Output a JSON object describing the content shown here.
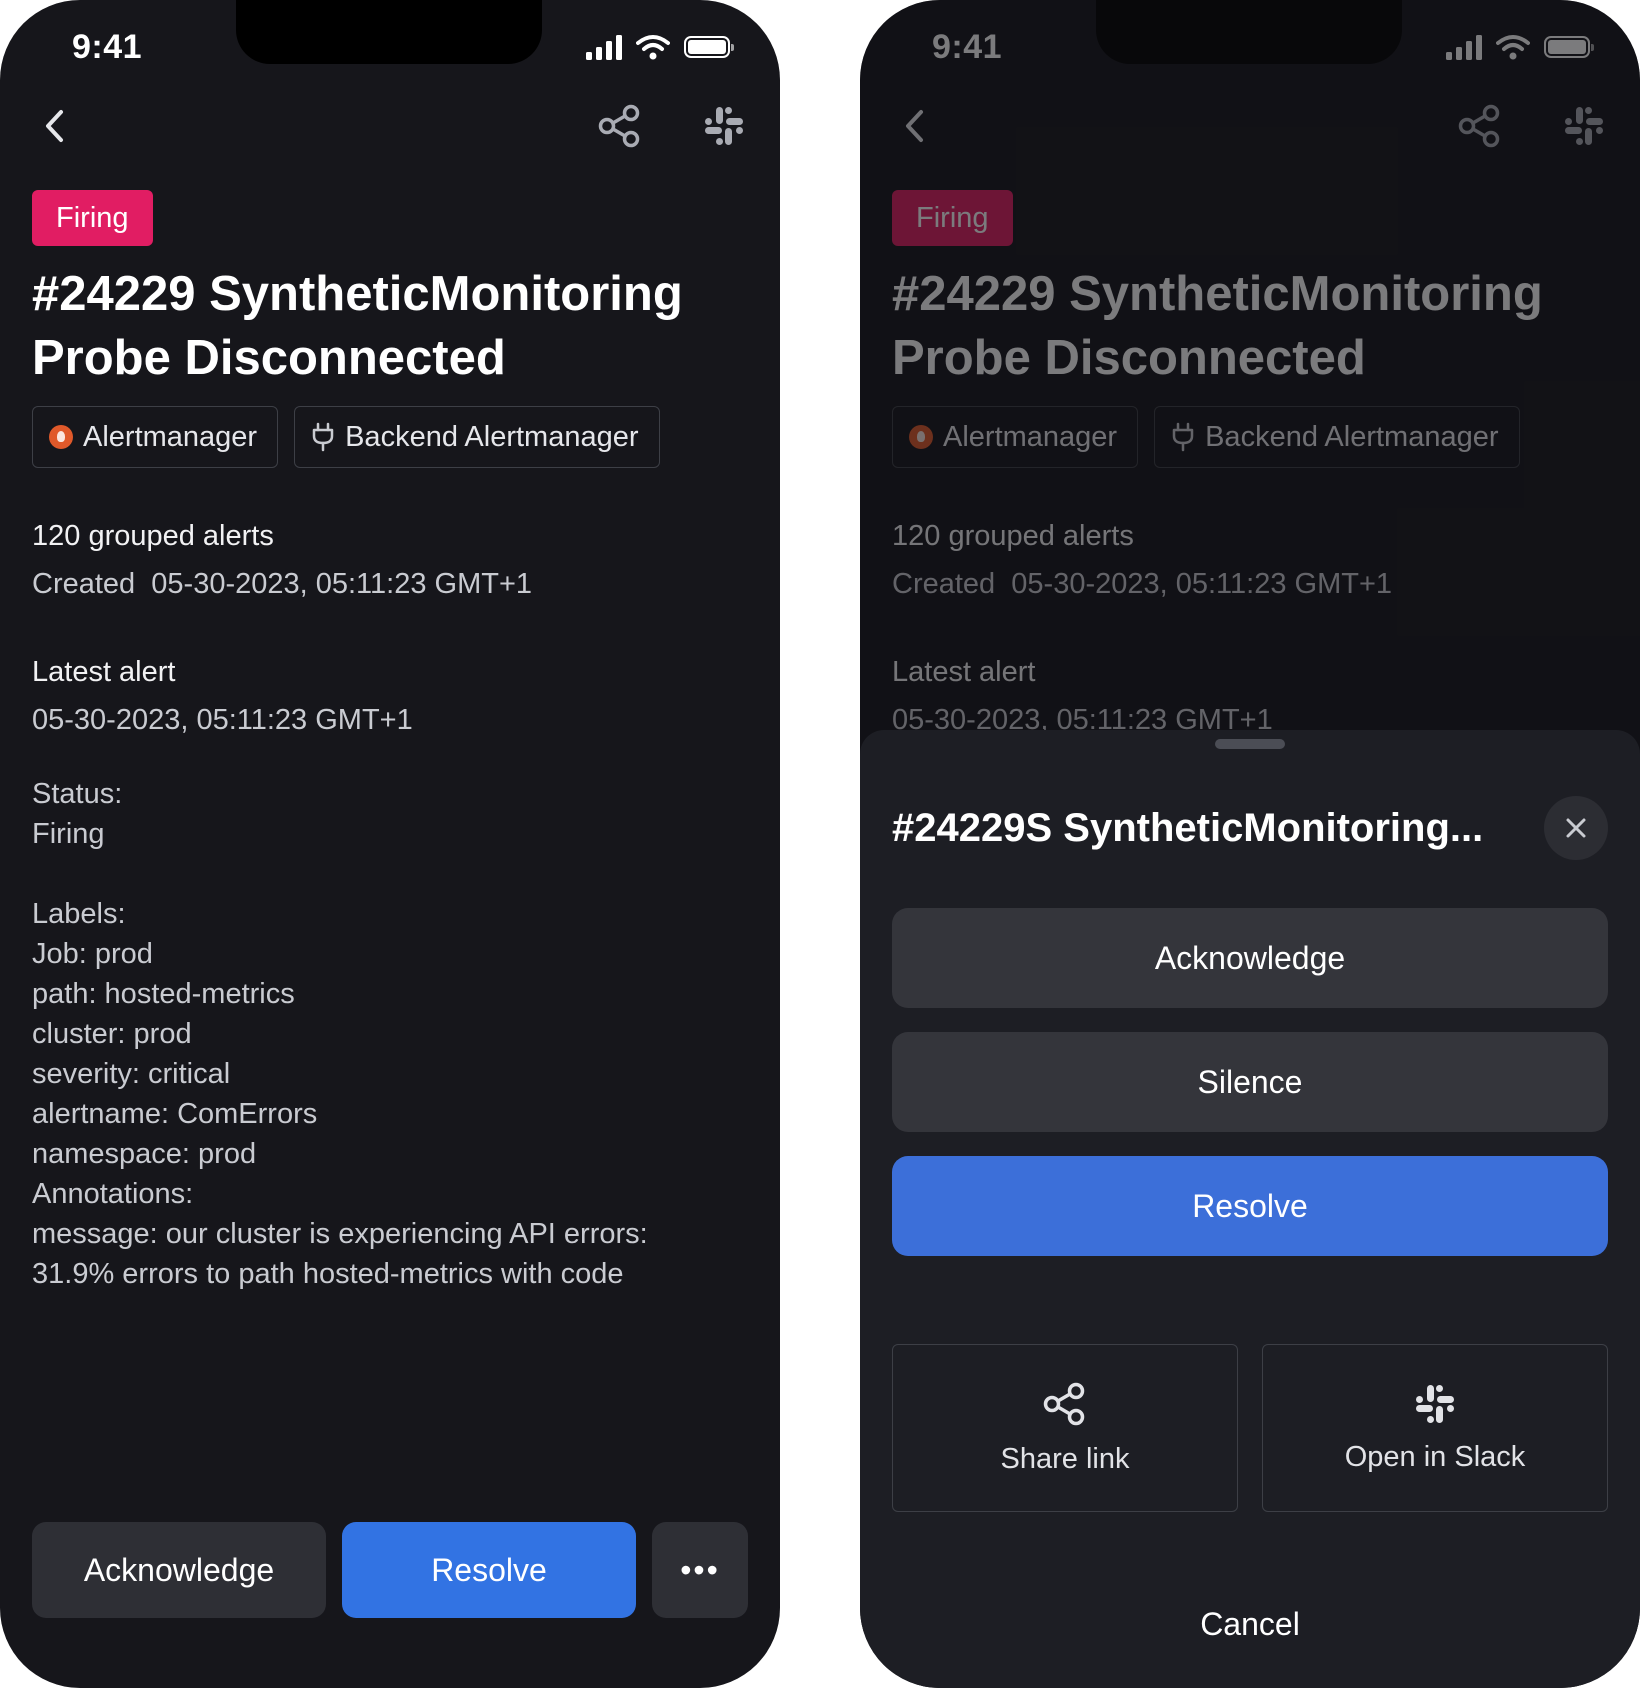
{
  "status_bar": {
    "time": "9:41"
  },
  "alert": {
    "status_badge": "Firing",
    "title": "#24229 SyntheticMonitoring Probe Disconnected",
    "integrations": [
      "Alertmanager",
      "Backend Alertmanager"
    ],
    "grouped_alerts": "120 grouped alerts",
    "created": "Created  05-30-2023, 05:11:23 GMT+1",
    "latest_label": "Latest alert",
    "latest_value": "05-30-2023, 05:11:23 GMT+1",
    "status_label": "Status:",
    "status_value": "Firing",
    "labels_header": "Labels:",
    "labels": [
      "Job: prod",
      "path: hosted-metrics",
      "cluster: prod",
      "severity: critical",
      "alertname: ComErrors",
      "namespace: prod"
    ],
    "annotations_header": "Annotations:",
    "annotations": [
      "message: our cluster is experiencing API errors:",
      "31.9% errors to path hosted-metrics with code"
    ]
  },
  "actions": {
    "acknowledge": "Acknowledge",
    "resolve": "Resolve",
    "more": "•••"
  },
  "sheet": {
    "title": "#24229S SyntheticMonitoring...",
    "acknowledge": "Acknowledge",
    "silence": "Silence",
    "resolve": "Resolve",
    "share_link": "Share link",
    "open_in_slack": "Open in Slack",
    "cancel": "Cancel"
  },
  "colors": {
    "background": "#16161b",
    "firing": "#e11d63",
    "primary": "#3273e3",
    "secondary_button": "#2e2f35"
  },
  "icons": [
    "back-icon",
    "share-icon",
    "slack-icon",
    "alertmanager-icon",
    "plug-icon",
    "close-icon",
    "more-icon"
  ]
}
